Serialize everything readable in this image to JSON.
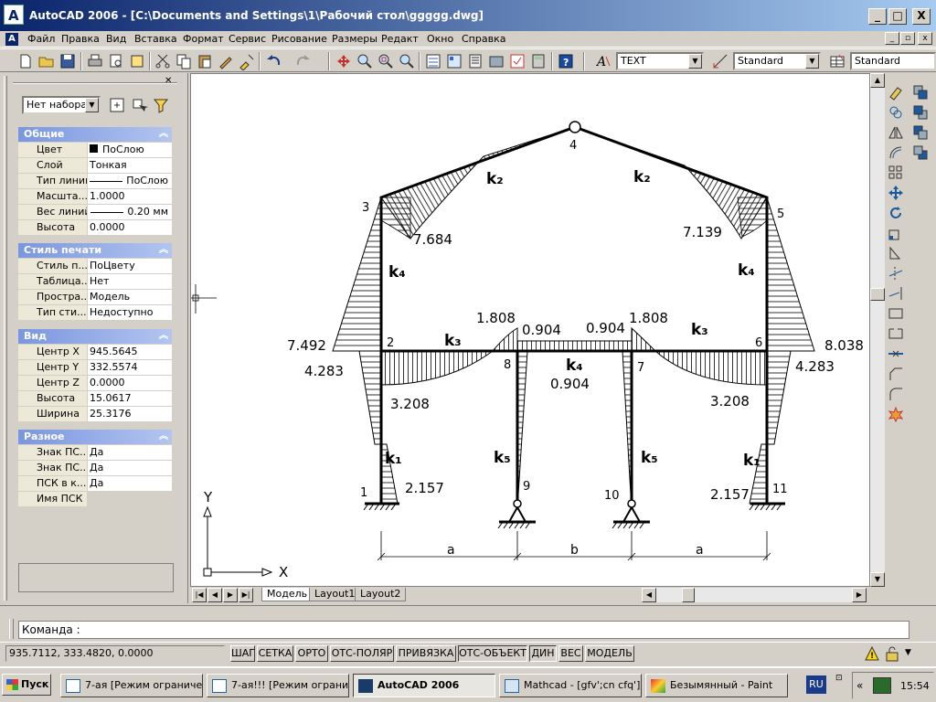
{
  "window": {
    "title": "AutoCAD 2006 - [C:\\Documents and Settings\\1\\Рабочий стол\\ggggg.dwg]",
    "minimize": "_",
    "maximize": "□",
    "close": "X"
  },
  "menu": {
    "items": [
      "Файл",
      "Правка",
      "Вид",
      "Вставка",
      "Формат",
      "Сервис",
      "Рисование",
      "Размеры",
      "Редакт",
      "Окно",
      "Справка"
    ]
  },
  "toolbar": {
    "text_style": "TEXT",
    "dim_style": "Standard",
    "table_style": "Standard"
  },
  "properties": {
    "selection": "Нет набора",
    "sections": [
      {
        "title": "Общие",
        "rows": [
          {
            "key": "Цвет",
            "value": "ПоСлою"
          },
          {
            "key": "Слой",
            "value": "Тонкая"
          },
          {
            "key": "Тип линий",
            "value": "ПоСлою"
          },
          {
            "key": "Масшта...",
            "value": "1.0000"
          },
          {
            "key": "Вес линий",
            "value": "0.20 мм"
          },
          {
            "key": "Высота",
            "value": "0.0000"
          }
        ]
      },
      {
        "title": "Стиль печати",
        "rows": [
          {
            "key": "Стиль п...",
            "value": "ПоЦвету"
          },
          {
            "key": "Таблица...",
            "value": "Нет"
          },
          {
            "key": "Простра...",
            "value": "Модель"
          },
          {
            "key": "Тип сти...",
            "value": "Недоступно"
          }
        ]
      },
      {
        "title": "Вид",
        "rows": [
          {
            "key": "Центр X",
            "value": "945.5645"
          },
          {
            "key": "Центр Y",
            "value": "332.5574"
          },
          {
            "key": "Центр Z",
            "value": "0.0000"
          },
          {
            "key": "Высота",
            "value": "15.0617"
          },
          {
            "key": "Ширина",
            "value": "25.3176"
          }
        ]
      },
      {
        "title": "Разное",
        "rows": [
          {
            "key": "Знак ПС...",
            "value": "Да"
          },
          {
            "key": "Знак ПС...",
            "value": "Да"
          },
          {
            "key": "ПСК в к...",
            "value": "Да"
          },
          {
            "key": "Имя ПСК",
            "value": ""
          }
        ]
      }
    ]
  },
  "drawing": {
    "node_labels": [
      "1",
      "2",
      "3",
      "4",
      "5",
      "6",
      "7",
      "8",
      "9",
      "10",
      "11"
    ],
    "stiffness_labels": {
      "k2_left": "k₂",
      "k2_right": "k₂",
      "k4_left": "k₄",
      "k4_right": "k₄",
      "k4_mid": "k₄",
      "k3_left": "k₃",
      "k3_right": "k₃",
      "k1_left": "k₁",
      "k1_right": "k₁",
      "k5_left": "k₅",
      "k5_right": "k₅"
    },
    "values": {
      "v7684": "7.684",
      "v7139": "7.139",
      "v1808a": "1.808",
      "v0904a": "0.904",
      "v0904b": "0.904",
      "v1808b": "1.808",
      "v7492": "7.492",
      "v8038": "8.038",
      "v4283a": "4.283",
      "v4283b": "4.283",
      "v0904c": "0.904",
      "v3208a": "3.208",
      "v3208b": "3.208",
      "v2157a": "2.157",
      "v2157b": "2.157"
    },
    "dims": {
      "a1": "a",
      "b": "b",
      "a2": "a"
    },
    "ucs": {
      "x": "X",
      "y": "Y"
    }
  },
  "tabs": [
    "Модель",
    "Layout1",
    "Layout2"
  ],
  "command": {
    "prompt": "Команда :"
  },
  "status": {
    "coords": "935.7112, 333.4820, 0.0000",
    "toggles": [
      "ШАГ",
      "СЕТКА",
      "ОРТО",
      "ОТС-ПОЛЯР",
      "ПРИВЯЗКА",
      "ОТС-ОБЪЕКТ",
      "ДИН",
      "ВЕС",
      "МОДЕЛЬ"
    ]
  },
  "taskbar": {
    "start": "Пуск",
    "tasks": [
      "7-ая [Режим ограниче...",
      "7-ая!!! [Режим ограни...",
      "AutoCAD 2006",
      "Mathcad - [gfv';cn cfq']",
      "Безымянный - Paint"
    ],
    "lang": "RU",
    "clock": "15:54"
  },
  "colors": {
    "title_start": "#0a246a",
    "title_end": "#a6caf0",
    "section_header": "#7a96df",
    "chrome": "#d4d0c8"
  }
}
